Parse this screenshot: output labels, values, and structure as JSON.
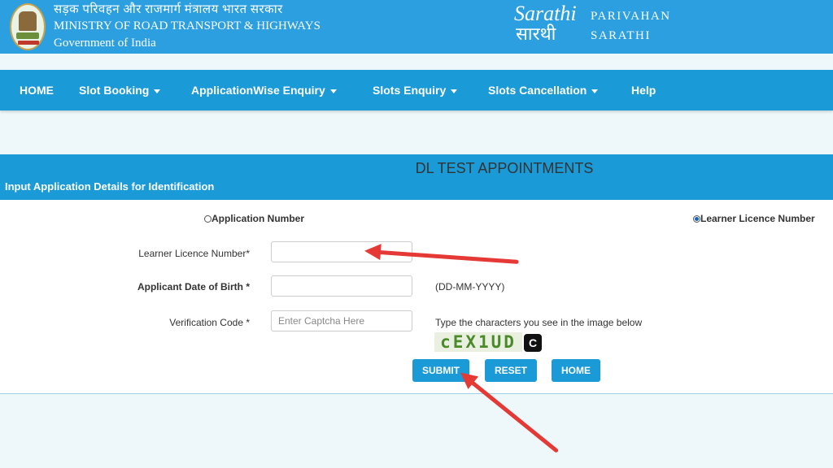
{
  "header": {
    "hindi_title": "सड़क परिवहन और राजमार्ग मंत्रालय भारत सरकार",
    "ministry_name": "MINISTRY OF ROAD TRANSPORT & HIGHWAYS",
    "government": "Government of India",
    "sarathi_en": "Sarathi",
    "sarathi_hi": "सारथी",
    "parivahan": "PARIVAHAN",
    "sarathi_caps": "SARATHI"
  },
  "nav": {
    "items": [
      {
        "label": "HOME"
      },
      {
        "label": "Slot Booking"
      },
      {
        "label": "ApplicationWise Enquiry"
      },
      {
        "label": "Slots Enquiry"
      },
      {
        "label": "Slots Cancellation"
      },
      {
        "label": "Help"
      }
    ]
  },
  "panel": {
    "title": "DL TEST APPOINTMENTS",
    "subtitle": "Input Application Details for Identification"
  },
  "form": {
    "radio_application": "Application Number",
    "radio_learner": "Learner Licence Number",
    "selected_radio": "Learner Licence Number",
    "learner_label": "Learner Licence Number*",
    "learner_value": "",
    "dob_label": "Applicant Date of Birth *",
    "dob_value": "",
    "dob_hint": "(DD-MM-YYYY)",
    "captcha_label": "Verification Code *",
    "captcha_placeholder": "Enter Captcha Here",
    "captcha_hint": "Type the characters you see in the image below",
    "captcha_text": "cEX1UD",
    "refresh_glyph": "C",
    "submit_label": "SUBMIT",
    "reset_label": "RESET",
    "home_label": "HOME"
  },
  "colors": {
    "header_bg": "#2b9fe0",
    "nav_bg": "#1a9ad6",
    "button_bg": "#1a9ad6",
    "annotation_arrow": "#e53935"
  }
}
